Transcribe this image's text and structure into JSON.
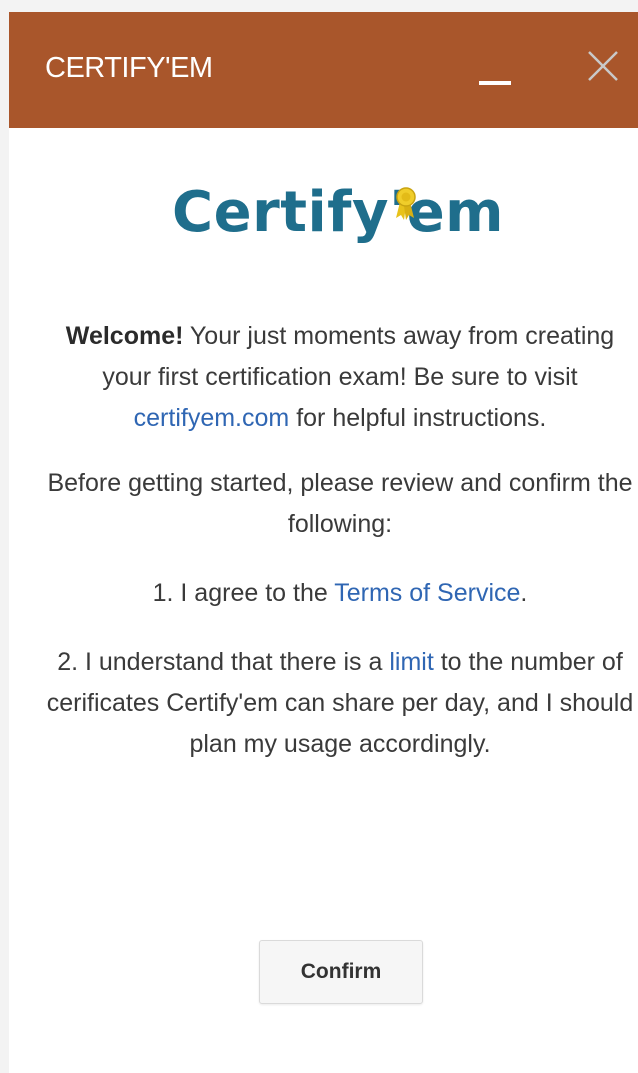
{
  "window": {
    "title": "CERTIFY'EM",
    "minimize_icon": "minimize-icon",
    "close_icon": "close-icon",
    "titlebar_color": "#a9562b"
  },
  "logo": {
    "text_main": "Certify",
    "text_apostrophe": "'",
    "text_end": "em",
    "ribbon_icon": "award-ribbon-icon",
    "color": "#1f6e8c"
  },
  "content": {
    "welcome_bold": "Welcome!",
    "welcome_text": " Your just moments away from creating your first certification exam! Be sure to visit ",
    "welcome_link": "certifyem.com",
    "welcome_tail": " for helpful instructions.",
    "review_text": "Before getting started, please review and confirm the following:",
    "item1_prefix": "1. I agree to the ",
    "item1_link": "Terms of Service",
    "item1_suffix": ".",
    "item2_prefix": "2. I understand that there is a ",
    "item2_link": "limit",
    "item2_suffix": " to the number of cerificates Certify'em can share per day, and I should plan my usage accordingly.",
    "link_color": "#2f66b3"
  },
  "actions": {
    "confirm_label": "Confirm"
  }
}
